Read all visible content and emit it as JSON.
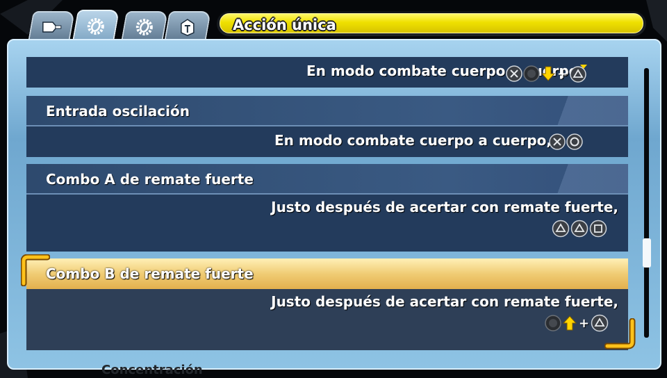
{
  "header": {
    "title": "Acción única",
    "tabs": [
      {
        "icon": "weapon-icon",
        "active": false
      },
      {
        "icon": "gear-icon",
        "active": true
      },
      {
        "icon": "gear-icon",
        "active": false
      },
      {
        "icon": "helmet-icon",
        "active": false
      }
    ]
  },
  "entries": [
    {
      "title": "",
      "description": "En modo combate cuerpo a cuerpo,",
      "buttons": [
        "cross-button-icon",
        "l-stick-icon",
        "down-arrow-icon",
        "plus",
        "triangle-hold-button-icon"
      ]
    },
    {
      "title": "Entrada oscilación",
      "description": "En modo combate cuerpo a cuerpo,",
      "buttons": [
        "cross-button-icon",
        "circle-button-icon"
      ]
    },
    {
      "title": "Combo A de remate fuerte",
      "description": "Justo después de acertar con remate fuerte,",
      "buttons": [
        "triangle-button-icon",
        "triangle-button-icon",
        "square-button-icon"
      ]
    },
    {
      "title": "Combo B de remate fuerte",
      "description": "Justo después de acertar con remate fuerte,",
      "buttons": [
        "l-stick-icon",
        "up-arrow-icon",
        "plus",
        "triangle-button-icon"
      ],
      "selected": true
    }
  ],
  "background_text": "Concentración",
  "plus_symbol": "+",
  "colors": {
    "selection": "#f0cc74",
    "title_bar": "#efe000",
    "frame": "#8ec3e4",
    "row_body": "#233b5c"
  }
}
